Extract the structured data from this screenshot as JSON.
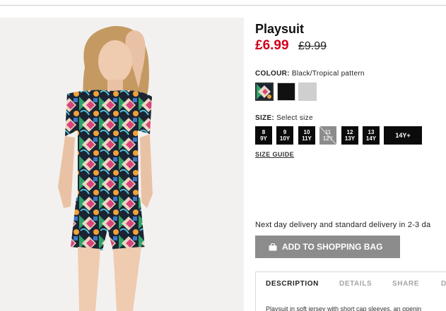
{
  "product": {
    "title": "Playsuit",
    "price_now": "£6.99",
    "price_was": "£9.99"
  },
  "colour": {
    "label": "COLOUR:",
    "value": "Black/Tropical pattern",
    "swatches": [
      "Black/Tropical pattern",
      "Black",
      "Grey marl"
    ]
  },
  "size": {
    "label": "SIZE:",
    "value": "Select size",
    "options": [
      {
        "line1": "8",
        "line2": "9Y",
        "available": true
      },
      {
        "line1": "9",
        "line2": "10Y",
        "available": true
      },
      {
        "line1": "10",
        "line2": "11Y",
        "available": true
      },
      {
        "line1": "11",
        "line2": "12Y",
        "available": false
      },
      {
        "line1": "12",
        "line2": "13Y",
        "available": true
      },
      {
        "line1": "13",
        "line2": "14Y",
        "available": true
      },
      {
        "line1": "14Y+",
        "line2": "",
        "available": true
      }
    ],
    "guide_label": "SIZE GUIDE"
  },
  "delivery_text": "Next day delivery and standard delivery in 2-3 da",
  "add_button_label": "ADD TO SHOPPING BAG",
  "tabs": [
    "DESCRIPTION",
    "DETAILS",
    "SHARE",
    "D"
  ],
  "description_text": "Playsuit in soft jersey with short cap sleeves, an openin",
  "icons": {
    "bag": "shopping-bag-icon"
  },
  "colors": {
    "price": "#d0021b",
    "button": "#8c8c8c",
    "size_button": "#0b0b0b"
  }
}
